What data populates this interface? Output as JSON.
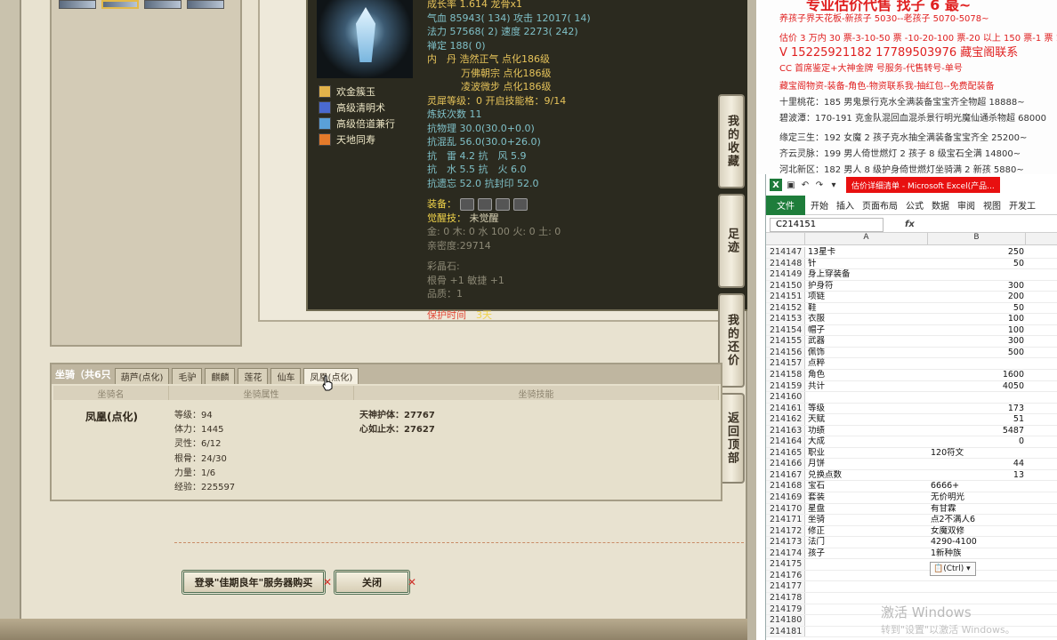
{
  "game": {
    "pet_stats": {
      "growth": "成长率 1.614 龙骨x1",
      "hp": "气血 85943( 134) 攻击 12017( 14)",
      "mp": "法力 57568( 2) 速度 2273( 242)",
      "chan": "禅定 188( 0)",
      "dan1": "内　丹 浩然正气 点化186级",
      "dan2": "万佛朝宗 点化186级",
      "dan3": "凌波微步 点化186级",
      "spirit": "灵犀等级：0 开启技能格：9/14",
      "refine": "炼妖次数 11",
      "kang1": "抗物理 30.0(30.0+0.0)",
      "kang2": "抗混乱 56.0(30.0+26.0)",
      "kang3": "抗　雷 4.2 抗　风 5.9",
      "kang4": "抗　水 5.5 抗　火 6.0",
      "kang5": "抗遗忘 52.0 抗封印 52.0",
      "equip": "装备：",
      "awake_label": "觉醒技：",
      "awake_value": "未觉醒",
      "elements": "金: 0 木: 0 水 100 火: 0 土: 0",
      "intimacy": "亲密度:29714",
      "gem_title": "彩晶石:",
      "gem_value": "根骨 +1 敏捷 +1",
      "quality": "品质：1",
      "protect_label": "保护时间",
      "protect_value": "3天"
    },
    "skills": [
      {
        "label": "欢金簇玉",
        "color": "#e2b24a"
      },
      {
        "label": "高级清明术",
        "color": "#4a6ad0"
      },
      {
        "label": "高级倍道兼行",
        "color": "#5aa0d8"
      },
      {
        "label": "天地同寿",
        "color": "#e47a2a"
      }
    ],
    "side_buttons": [
      {
        "label": "我的收藏"
      },
      {
        "label": "足迹"
      },
      {
        "label": "我的还价"
      },
      {
        "label": "返回顶部"
      }
    ],
    "mount": {
      "title": "坐骑（共6只",
      "tabs": [
        "葫芦(点化)",
        "毛驴",
        "麒麟",
        "莲花",
        "仙车",
        "凤凰(点化)"
      ],
      "header": [
        "坐骑名",
        "坐骑属性",
        "坐骑技能"
      ],
      "name": "凤凰(点化)",
      "attrs": [
        "等级：94",
        "体力：1445",
        "灵性：6/12",
        "根骨：24/30",
        "力量：1/6",
        "经验：225597"
      ],
      "skills": [
        "天神护体：27767",
        "心如止水：27627"
      ]
    },
    "buttons": {
      "login": "登录\"佳期良年\"服务器购买",
      "close": "关闭"
    }
  },
  "ad": {
    "top": "专业估价代售 找子 6 最~",
    "lines": [
      "养孩子界天花板-新孩子 5030--老孩子 5070-5078~",
      "估价 3 万内 30 票-3-10-50 票 -10-20-100 票-20 以上 150 票-1 票 1",
      "V 15225921182     17789503976  藏宝阁联系",
      "CC 首席鉴定+大神金牌 号服务-代售转号-单号",
      "藏宝阁物资-装备-角色-物资联系我-抽红包--免费配装备",
      "十里桃花：185 男鬼景行克水全满装备宝宝齐全物超 18888~",
      "碧波潭：170-191 克金队混回血混杀景行明光魔仙通杀物超 68000",
      "缘定三生：192 女魔 2 孩子克水抽全满装备宝宝齐全 25200~",
      "齐云灵脉：199 男人倚世燃灯 2 孩子 8 级宝石全满 14800~",
      "河北新区：182 男人 8 级护身倚世燃灯坐骑满 2 新孩 5880~"
    ]
  },
  "excel": {
    "title": "估价详细清单 - Microsoft Excel(产品...",
    "ribbon": [
      "文件",
      "开始",
      "插入",
      "页面布局",
      "公式",
      "数据",
      "审阅",
      "视图",
      "开发工"
    ],
    "namebox": "C214151",
    "fx": "fx",
    "col_a": "A",
    "col_b": "B",
    "paste": "(Ctrl) ▾",
    "rows": [
      {
        "n": "214147",
        "a": "13星卡",
        "b": "250",
        "t": "num"
      },
      {
        "n": "214148",
        "a": "针",
        "b": "50",
        "t": "num"
      },
      {
        "n": "214149",
        "a": "身上穿装备",
        "b": "",
        "t": "num"
      },
      {
        "n": "214150",
        "a": "护身符",
        "b": "300",
        "t": "num"
      },
      {
        "n": "214151",
        "a": "项链",
        "b": "200",
        "t": "num"
      },
      {
        "n": "214152",
        "a": "鞋",
        "b": "50",
        "t": "num"
      },
      {
        "n": "214153",
        "a": "衣服",
        "b": "100",
        "t": "num"
      },
      {
        "n": "214154",
        "a": "帽子",
        "b": "100",
        "t": "num"
      },
      {
        "n": "214155",
        "a": "武器",
        "b": "300",
        "t": "num"
      },
      {
        "n": "214156",
        "a": "佩饰",
        "b": "500",
        "t": "num"
      },
      {
        "n": "214157",
        "a": "点粹",
        "b": "",
        "t": "num"
      },
      {
        "n": "214158",
        "a": "角色",
        "b": "1600",
        "t": "num"
      },
      {
        "n": "214159",
        "a": "共计",
        "b": "4050",
        "t": "num"
      },
      {
        "n": "214160",
        "a": "",
        "b": "",
        "t": "num"
      },
      {
        "n": "214161",
        "a": "等级",
        "b": "173",
        "t": "num"
      },
      {
        "n": "214162",
        "a": "天赋",
        "b": "51",
        "t": "num"
      },
      {
        "n": "214163",
        "a": "功绩",
        "b": "5487",
        "t": "num"
      },
      {
        "n": "214164",
        "a": "大成",
        "b": "0",
        "t": "num"
      },
      {
        "n": "214165",
        "a": "职业",
        "b": "120符文",
        "t": "txt"
      },
      {
        "n": "214166",
        "a": "月饼",
        "b": "44",
        "t": "num"
      },
      {
        "n": "214167",
        "a": "兑换点数",
        "b": "13",
        "t": "num"
      },
      {
        "n": "214168",
        "a": "宝石",
        "b": "6666+",
        "t": "txt"
      },
      {
        "n": "214169",
        "a": "套装",
        "b": "无价明光",
        "t": "txt"
      },
      {
        "n": "214170",
        "a": "星盘",
        "b": "有甘霖",
        "t": "txt"
      },
      {
        "n": "214171",
        "a": "坐骑",
        "b": "点2不满人6",
        "t": "txt"
      },
      {
        "n": "214172",
        "a": "修正",
        "b": "女魔双修",
        "t": "txt"
      },
      {
        "n": "214173",
        "a": "法门",
        "b": "4290-4100",
        "t": "txt"
      },
      {
        "n": "214174",
        "a": "孩子",
        "b": "1新种族",
        "t": "txt"
      },
      {
        "n": "214175",
        "a": "",
        "b": "",
        "t": "num"
      },
      {
        "n": "214176",
        "a": "",
        "b": "",
        "t": "num"
      },
      {
        "n": "214177",
        "a": "",
        "b": "",
        "t": "num"
      },
      {
        "n": "214178",
        "a": "",
        "b": "",
        "t": "num"
      },
      {
        "n": "214179",
        "a": "",
        "b": "",
        "t": "num"
      },
      {
        "n": "214180",
        "a": "",
        "b": "",
        "t": "num"
      },
      {
        "n": "214181",
        "a": "",
        "b": "",
        "t": "num"
      }
    ]
  },
  "watermark": {
    "line1": "激活 Windows",
    "line2": "转到\"设置\"以激活 Windows。"
  }
}
